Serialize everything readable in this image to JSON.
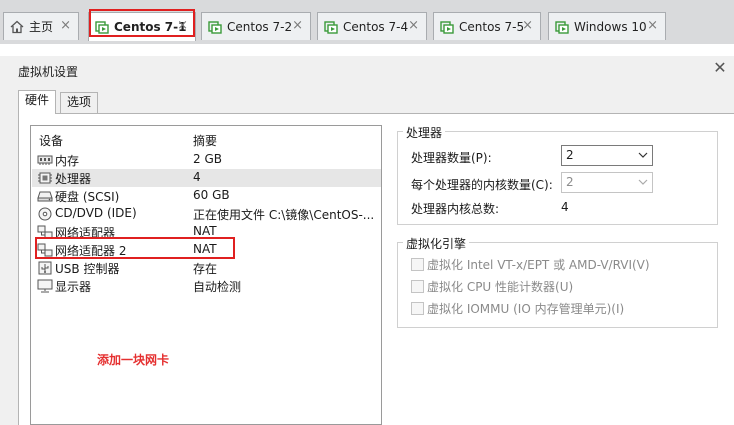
{
  "tabs": [
    {
      "label": "主页",
      "icon": "home-icon",
      "active": false
    },
    {
      "label": "Centos 7-1",
      "icon": "vm-icon",
      "active": true
    },
    {
      "label": "Centos 7-2",
      "icon": "vm-icon",
      "active": false
    },
    {
      "label": "Centos 7-4",
      "icon": "vm-icon",
      "active": false
    },
    {
      "label": "Centos 7-5",
      "icon": "vm-icon",
      "active": false
    },
    {
      "label": "Windows 10",
      "icon": "vm-icon",
      "active": false
    }
  ],
  "tab_close_glyph": "×",
  "dialog": {
    "title": "虚拟机设置",
    "close_glyph": "✕",
    "tabs": [
      "硬件",
      "选项"
    ]
  },
  "devices": {
    "header_device": "设备",
    "header_summary": "摘要",
    "rows": [
      {
        "name": "内存",
        "summary": "2 GB",
        "icon": "memory-icon"
      },
      {
        "name": "处理器",
        "summary": "4",
        "icon": "cpu-icon"
      },
      {
        "name": "硬盘 (SCSI)",
        "summary": "60 GB",
        "icon": "hard-disk-icon"
      },
      {
        "name": "CD/DVD (IDE)",
        "summary": "正在使用文件 C:\\镜像\\CentOS-...",
        "icon": "cd-dvd-icon"
      },
      {
        "name": "网络适配器",
        "summary": "NAT",
        "icon": "network-adapter-icon"
      },
      {
        "name": "网络适配器 2",
        "summary": "NAT",
        "icon": "network-adapter-icon"
      },
      {
        "name": "USB 控制器",
        "summary": "存在",
        "icon": "usb-icon"
      },
      {
        "name": "显示器",
        "summary": "自动检测",
        "icon": "monitor-icon"
      }
    ],
    "selected_index": 1
  },
  "annotation_note": "添加一块网卡",
  "processor": {
    "group_title": "处理器",
    "count_label": "处理器数量(P):",
    "count_value": "2",
    "cores_label": "每个处理器的内核数量(C):",
    "cores_value": "2",
    "total_label": "处理器内核总数:",
    "total_value": "4"
  },
  "virtualization": {
    "group_title": "虚拟化引擎",
    "options": [
      "虚拟化 Intel VT-x/EPT 或 AMD-V/RVI(V)",
      "虚拟化 CPU 性能计数器(U)",
      "虚拟化 IOMMU (IO 内存管理单元)(I)"
    ]
  },
  "colors": {
    "highlight_red": "#e02020",
    "note_red": "#e53030",
    "vm_icon_green": "#3a9a3a"
  }
}
